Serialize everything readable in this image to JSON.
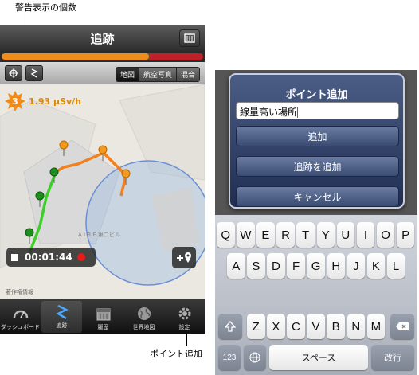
{
  "annotations": {
    "warning_count": "警告表示の個数",
    "add_point": "ポイント追加"
  },
  "left": {
    "nav": {
      "title": "追跡",
      "right_button_icon": "list-icon"
    },
    "warning_bar": {
      "fill_fraction": 0.73,
      "red_fraction": 0.27,
      "fill_color": "#f08c1a",
      "red_color": "#c0202a"
    },
    "toolbar": {
      "buttons": [
        {
          "icon": "crosshair-icon"
        },
        {
          "icon": "route-icon"
        }
      ],
      "segments": [
        "地図",
        "航空写真",
        "混合"
      ],
      "active_segment": 0
    },
    "map": {
      "building_label": "A I B E 第二ビル",
      "radiation": {
        "warning_count": "3",
        "value": "1.93 μSv/h",
        "accent": "#f08c1a"
      }
    },
    "timer": {
      "time": "00:01:44"
    },
    "attribution": "著作権情報",
    "tabs": [
      {
        "label": "ダッシュボード",
        "icon": "gauge-icon"
      },
      {
        "label": "追跡",
        "icon": "route-icon"
      },
      {
        "label": "履歴",
        "icon": "calendar-icon"
      },
      {
        "label": "世界地図",
        "icon": "globe-icon"
      },
      {
        "label": "設定",
        "icon": "gear-icon"
      }
    ],
    "active_tab": 1
  },
  "right": {
    "alert": {
      "title": "ポイント追加",
      "input_value": "線量高い場所",
      "buttons": [
        "追加",
        "追跡を追加",
        "キャンセル"
      ]
    },
    "keyboard": {
      "row1": [
        "Q",
        "W",
        "E",
        "R",
        "T",
        "Y",
        "U",
        "I",
        "O",
        "P"
      ],
      "row2": [
        "A",
        "S",
        "D",
        "F",
        "G",
        "H",
        "J",
        "K",
        "L"
      ],
      "row3": [
        "Z",
        "X",
        "C",
        "V",
        "B",
        "N",
        "M"
      ],
      "numbers_key": "123",
      "space_key": "スペース",
      "return_key": "改行"
    }
  }
}
